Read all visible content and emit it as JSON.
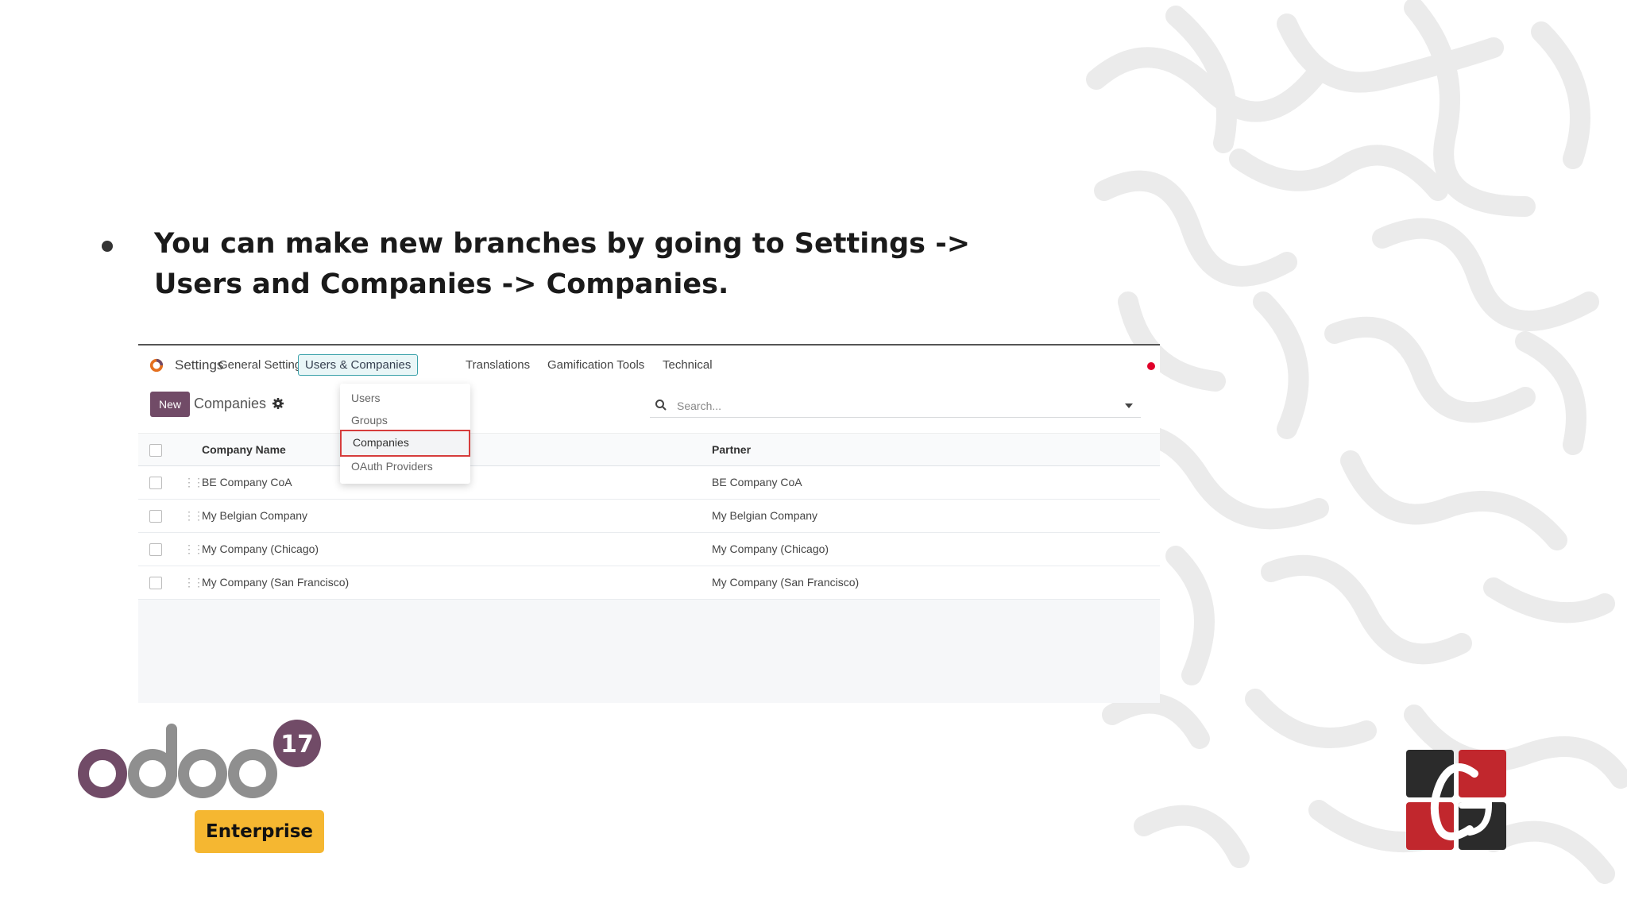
{
  "slide": {
    "bullet_line1": "You can make new branches by going to Settings ->",
    "bullet_line2": "Users and Companies -> Companies."
  },
  "screenshot": {
    "app_name": "Settings",
    "nav": [
      "General Settings",
      "Users & Companies",
      "Translations",
      "Gamification Tools",
      "Technical"
    ],
    "active_nav": "Users & Companies",
    "new_button": "New",
    "breadcrumb": "Companies",
    "search_placeholder": "Search...",
    "dropdown": [
      "Users",
      "Groups",
      "Companies",
      "OAuth Providers"
    ],
    "highlighted_item": "Companies",
    "columns": [
      "Company Name",
      "Partner"
    ],
    "rows": [
      {
        "name": "BE Company CoA",
        "partner": "BE Company CoA"
      },
      {
        "name": "My Belgian Company",
        "partner": "My Belgian Company"
      },
      {
        "name": "My Company (Chicago)",
        "partner": "My Company (Chicago)"
      },
      {
        "name": "My Company (San Francisco)",
        "partner": "My Company (San Francisco)"
      }
    ],
    "colors": {
      "brand": "#714b67",
      "active_nav_border": "#3aa1a9",
      "highlight_border": "#d63c3c",
      "notification": "#e0002a"
    }
  },
  "branding": {
    "odoo_word": "odoo",
    "version": "17",
    "edition": "Enterprise",
    "colors": {
      "odoo_purple": "#714b67",
      "odoo_gray": "#8f8f8f",
      "enterprise": "#f5b731",
      "cg_red": "#c1272d",
      "cg_dark": "#2b2b2b"
    }
  }
}
